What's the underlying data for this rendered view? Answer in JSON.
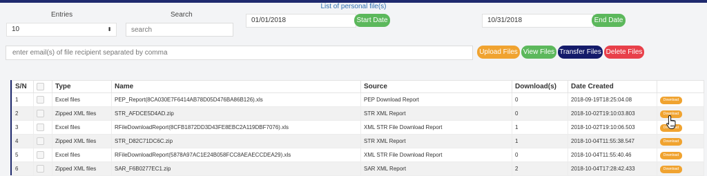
{
  "header": {
    "title": "List of personal file(s)"
  },
  "filters": {
    "entries_label": "Entries",
    "entries_value": "10",
    "search_label": "Search",
    "search_placeholder": "search",
    "start_date": "01/01/2018",
    "start_date_button": "Start Date",
    "end_date": "10/31/2018",
    "end_date_button": "End Date"
  },
  "recipient": {
    "placeholder": "enter email(s) of file recipient separated by comma"
  },
  "actions": {
    "upload": "Upload Files",
    "view": "View Files",
    "transfer": "Transfer Files",
    "delete": "Delete Files"
  },
  "table": {
    "headers": [
      "S/N",
      "",
      "Type",
      "Name",
      "Source",
      "Download(s)",
      "Date Created",
      ""
    ],
    "download_label": "Download",
    "rows": [
      {
        "sn": "1",
        "type": "Excel files",
        "name": "PEP_Report(8CA030E7F6414AB78D05D476BA86B126).xls",
        "source": "PEP Download Report",
        "downloads": "0",
        "date": "2018-09-19T18:25:04.08"
      },
      {
        "sn": "2",
        "type": "Zipped XML files",
        "name": "STR_AFDCE5D4AD.zip",
        "source": "STR XML Report",
        "downloads": "0",
        "date": "2018-10-02T19:10:03.803"
      },
      {
        "sn": "3",
        "type": "Excel files",
        "name": "RFileDownloadReport(8CFB1872DD3D43FE8EBC2A119DBF7076).xls",
        "source": "XML STR File Download Report",
        "downloads": "1",
        "date": "2018-10-02T19:10:06.503"
      },
      {
        "sn": "4",
        "type": "Zipped XML files",
        "name": "STR_D82C71DC6C.zip",
        "source": "STR XML Report",
        "downloads": "1",
        "date": "2018-10-04T11:55:38.547"
      },
      {
        "sn": "5",
        "type": "Excel files",
        "name": "RFileDownloadReport(5878A97AC1E24B058FCC8AEAECCDEA29).xls",
        "source": "XML STR File Download Report",
        "downloads": "0",
        "date": "2018-10-04T11:55:40.46"
      },
      {
        "sn": "6",
        "type": "Zipped XML files",
        "name": "SAR_F6B0277EC1.zip",
        "source": "SAR XML Report",
        "downloads": "2",
        "date": "2018-10-04T17:28:42.433"
      }
    ]
  },
  "colors": {
    "topbar": "#1f2a6e",
    "green": "#5cb85c",
    "orange": "#f0a330",
    "navy": "#141b6a",
    "red": "#e8404a"
  },
  "icons": {
    "cursor": "hand-pointer-icon",
    "select_caret": "caret-updown-icon"
  }
}
